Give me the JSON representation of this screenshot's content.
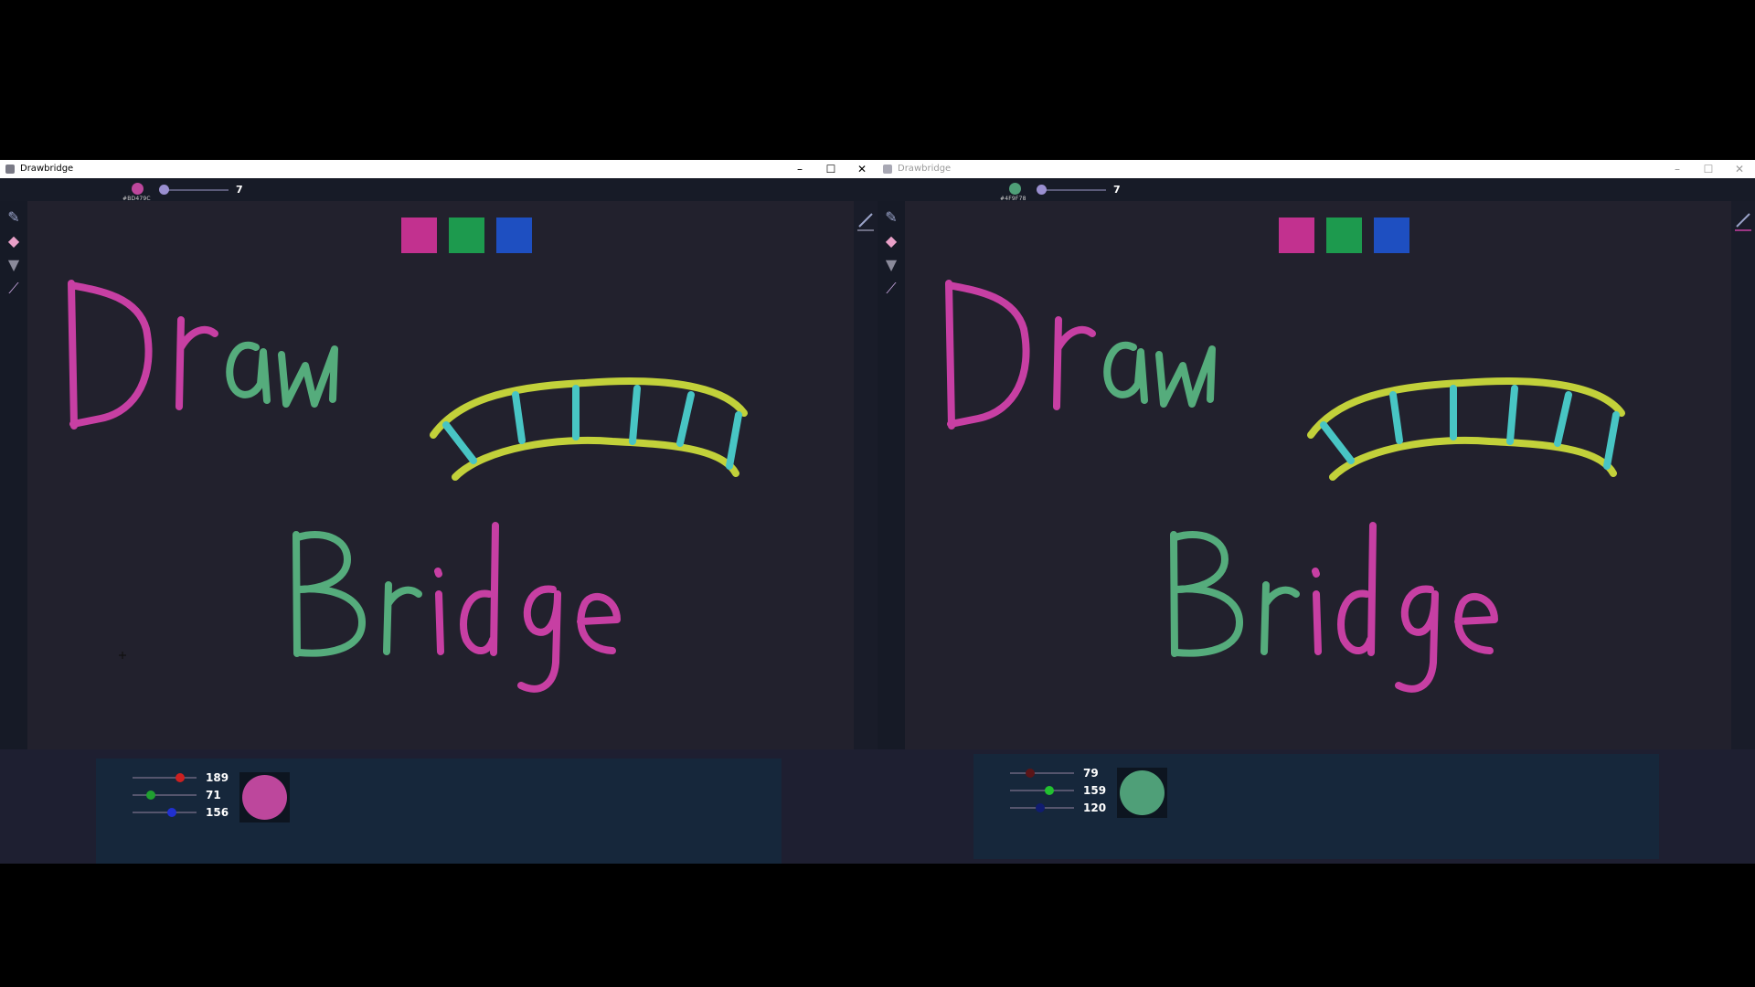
{
  "windows": [
    {
      "title": "Drawbridge",
      "title_controls": [
        "–",
        "☐",
        "✕"
      ],
      "brush": {
        "color": "#bd479c",
        "hex_label": "#BD479C",
        "size": "7"
      },
      "tools": [
        "pencil-icon",
        "eraser-icon",
        "bucket-icon",
        "eyedropper-icon"
      ],
      "presets": [
        "#c2318f",
        "#1d9a4e",
        "#1e4fc1"
      ],
      "rgb": {
        "r": "189",
        "g": "71",
        "b": "156",
        "r_frac": 0.74,
        "g_frac": 0.28,
        "b_frac": 0.61
      },
      "preview_color": "#bd479c",
      "active": true
    },
    {
      "title": "Drawbridge",
      "title_controls": [
        "–",
        "☐",
        "✕"
      ],
      "brush": {
        "color": "#4f9f78",
        "hex_label": "#4F9F78",
        "size": "7"
      },
      "tools": [
        "pencil-icon",
        "eraser-icon",
        "bucket-icon",
        "eyedropper-icon"
      ],
      "presets": [
        "#c2318f",
        "#1d9a4e",
        "#1e4fc1"
      ],
      "rgb": {
        "r": "79",
        "g": "159",
        "b": "120",
        "r_frac": 0.31,
        "g_frac": 0.62,
        "b_frac": 0.47
      },
      "preview_color": "#4f9f78",
      "active": false
    }
  ],
  "drawing": {
    "words": [
      "Draw",
      "Bridge"
    ],
    "stroke_colors": {
      "magenta": "#c73fa3",
      "green": "#55ac7c",
      "yellow": "#c2d13a",
      "cyan": "#48c5c4"
    }
  }
}
